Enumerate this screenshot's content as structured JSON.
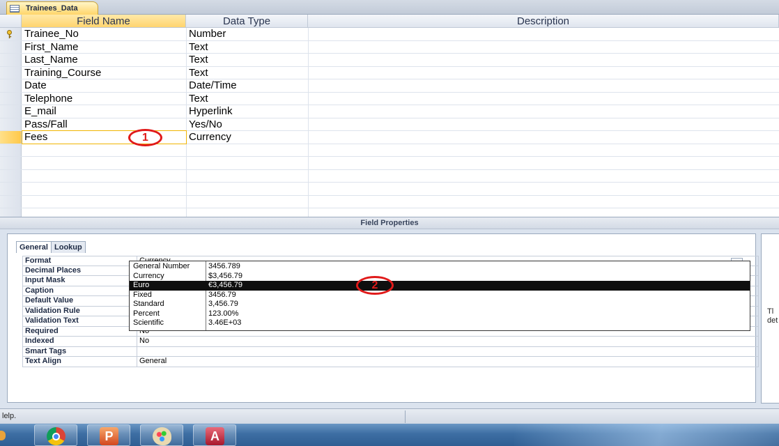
{
  "document_tab": {
    "title": "Trainees_Data"
  },
  "grid": {
    "headers": {
      "field_name": "Field Name",
      "data_type": "Data Type",
      "description": "Description"
    },
    "rows": [
      {
        "field": "Trainee_No",
        "type": "Number",
        "primary_key": true
      },
      {
        "field": "First_Name",
        "type": "Text"
      },
      {
        "field": "Last_Name",
        "type": "Text"
      },
      {
        "field": "Training_Course",
        "type": "Text"
      },
      {
        "field": "Date",
        "type": "Date/Time"
      },
      {
        "field": "Telephone",
        "type": "Text"
      },
      {
        "field": "E_mail",
        "type": "Hyperlink"
      },
      {
        "field": "Pass/Fall",
        "type": "Yes/No"
      },
      {
        "field": "Fees",
        "type": "Currency",
        "selected": true
      }
    ]
  },
  "field_properties": {
    "title": "Field Properties",
    "tabs": [
      "General",
      "Lookup"
    ],
    "active_tab": "General",
    "rows": [
      {
        "label": "Format",
        "value": "Currency"
      },
      {
        "label": "Decimal Places",
        "value": ""
      },
      {
        "label": "Input Mask",
        "value": ""
      },
      {
        "label": "Caption",
        "value": ""
      },
      {
        "label": "Default Value",
        "value": ""
      },
      {
        "label": "Validation Rule",
        "value": ""
      },
      {
        "label": "Validation Text",
        "value": ""
      },
      {
        "label": "Required",
        "value": "No"
      },
      {
        "label": "Indexed",
        "value": "No"
      },
      {
        "label": "Smart Tags",
        "value": ""
      },
      {
        "label": "Text Align",
        "value": "General"
      }
    ],
    "format_dropdown": [
      {
        "name": "General Number",
        "example": "3456.789"
      },
      {
        "name": "Currency",
        "example": "$3,456.79"
      },
      {
        "name": "Euro",
        "example": "€3,456.79",
        "highlighted": true
      },
      {
        "name": "Fixed",
        "example": "3456.79"
      },
      {
        "name": "Standard",
        "example": "3,456.79"
      },
      {
        "name": "Percent",
        "example": "123.00%"
      },
      {
        "name": "Scientific",
        "example": "3.46E+03"
      }
    ],
    "side_text": [
      "Tl",
      "det"
    ]
  },
  "callouts": {
    "one": "1",
    "two": "2"
  },
  "status_bar": {
    "text": "lelp."
  },
  "taskbar": {
    "icons": [
      "chrome-icon",
      "powerpoint-icon",
      "paint-icon",
      "access-icon"
    ],
    "ppt_letter": "P",
    "access_letter": "A"
  },
  "colors": {
    "selection_yellow": "#ffd46e",
    "callout_red": "#e01a1a",
    "highlight_black": "#0f0f0f"
  }
}
